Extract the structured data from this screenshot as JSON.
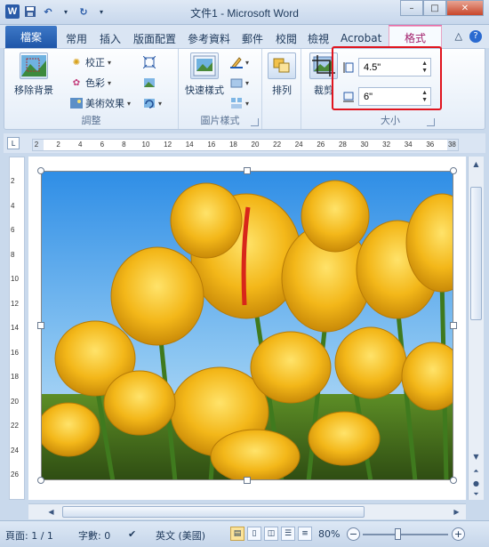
{
  "titlebar": {
    "title": "文件1 - Microsoft Word",
    "app_icon": "W",
    "window_buttons": {
      "minimize": "–",
      "maximize": "□",
      "close": "✕"
    }
  },
  "tabs": {
    "file": "檔案",
    "items": [
      "常用",
      "插入",
      "版面配置",
      "參考資料",
      "郵件",
      "校閱",
      "檢視",
      "Acrobat"
    ],
    "active_contextual": "格式",
    "right": {
      "minimize_ribbon": "△",
      "help": "?"
    }
  },
  "ribbon": {
    "adjust": {
      "remove_bg": "移除背景",
      "corrections": "校正",
      "color": "色彩",
      "artistic": "美術效果",
      "label": "調整"
    },
    "picture_styles": {
      "quick_styles": "快速樣式",
      "label": "圖片樣式"
    },
    "arrange": {
      "label": "排列"
    },
    "size": {
      "crop": "裁剪",
      "height": "4.5\"",
      "width": "6\"",
      "label": "大小"
    }
  },
  "ruler": {
    "h_numbers": [
      "2",
      "2",
      "4",
      "6",
      "8",
      "10",
      "12",
      "14",
      "16",
      "18",
      "20",
      "22",
      "24",
      "26",
      "28",
      "30",
      "32",
      "34",
      "36",
      "38"
    ],
    "v_numbers": [
      "2",
      "4",
      "6",
      "8",
      "10",
      "12",
      "14",
      "16",
      "18",
      "20",
      "22",
      "24",
      "26"
    ]
  },
  "status": {
    "page": "頁面: 1 / 1",
    "words": "字數: 0",
    "language": "英文 (美國)",
    "zoom": "80%"
  }
}
